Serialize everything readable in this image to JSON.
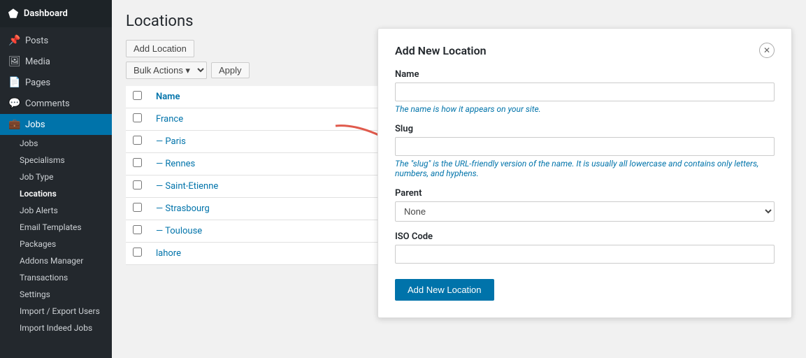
{
  "sidebar": {
    "dashboard": {
      "label": "Dashboard",
      "icon": "⬛"
    },
    "posts": {
      "label": "Posts",
      "icon": "📌"
    },
    "media": {
      "label": "Media",
      "icon": "🖼"
    },
    "pages": {
      "label": "Pages",
      "icon": "📄"
    },
    "comments": {
      "label": "Comments",
      "icon": "💬"
    },
    "jobs": {
      "label": "Jobs",
      "icon": "💼"
    },
    "sub_items": [
      {
        "label": "Jobs",
        "key": "jobs-sub"
      },
      {
        "label": "Specialisms",
        "key": "specialisms"
      },
      {
        "label": "Job Type",
        "key": "job-type"
      },
      {
        "label": "Locations",
        "key": "locations",
        "active": true
      },
      {
        "label": "Job Alerts",
        "key": "job-alerts"
      },
      {
        "label": "Email Templates",
        "key": "email-templates"
      },
      {
        "label": "Packages",
        "key": "packages"
      },
      {
        "label": "Addons Manager",
        "key": "addons-manager"
      },
      {
        "label": "Transactions",
        "key": "transactions"
      },
      {
        "label": "Settings",
        "key": "settings"
      },
      {
        "label": "Import / Export Users",
        "key": "import-export"
      },
      {
        "label": "Import Indeed Jobs",
        "key": "import-indeed"
      }
    ]
  },
  "page": {
    "title": "Locations",
    "add_button": "Add Location",
    "bulk_actions_label": "Bulk Actions",
    "apply_label": "Apply"
  },
  "table": {
    "column_name": "Name",
    "rows": [
      {
        "label": "France",
        "indent": false
      },
      {
        "label": "— Paris",
        "indent": true
      },
      {
        "label": "— Rennes",
        "indent": true
      },
      {
        "label": "— Saint-Etienne",
        "indent": true
      },
      {
        "label": "— Strasbourg",
        "indent": true
      },
      {
        "label": "— Toulouse",
        "indent": true
      },
      {
        "label": "lahore",
        "indent": false
      }
    ]
  },
  "modal": {
    "title": "Add New Location",
    "close_icon": "✕",
    "name_label": "Name",
    "name_placeholder": "",
    "name_hint": "The name is how it appears on your site.",
    "slug_label": "Slug",
    "slug_placeholder": "",
    "slug_hint": "The \"slug\" is the URL-friendly version of the name. It is usually all lowercase and contains only letters, numbers, and hyphens.",
    "parent_label": "Parent",
    "parent_options": [
      "None"
    ],
    "iso_label": "ISO Code",
    "iso_placeholder": "",
    "submit_label": "Add New Location"
  }
}
